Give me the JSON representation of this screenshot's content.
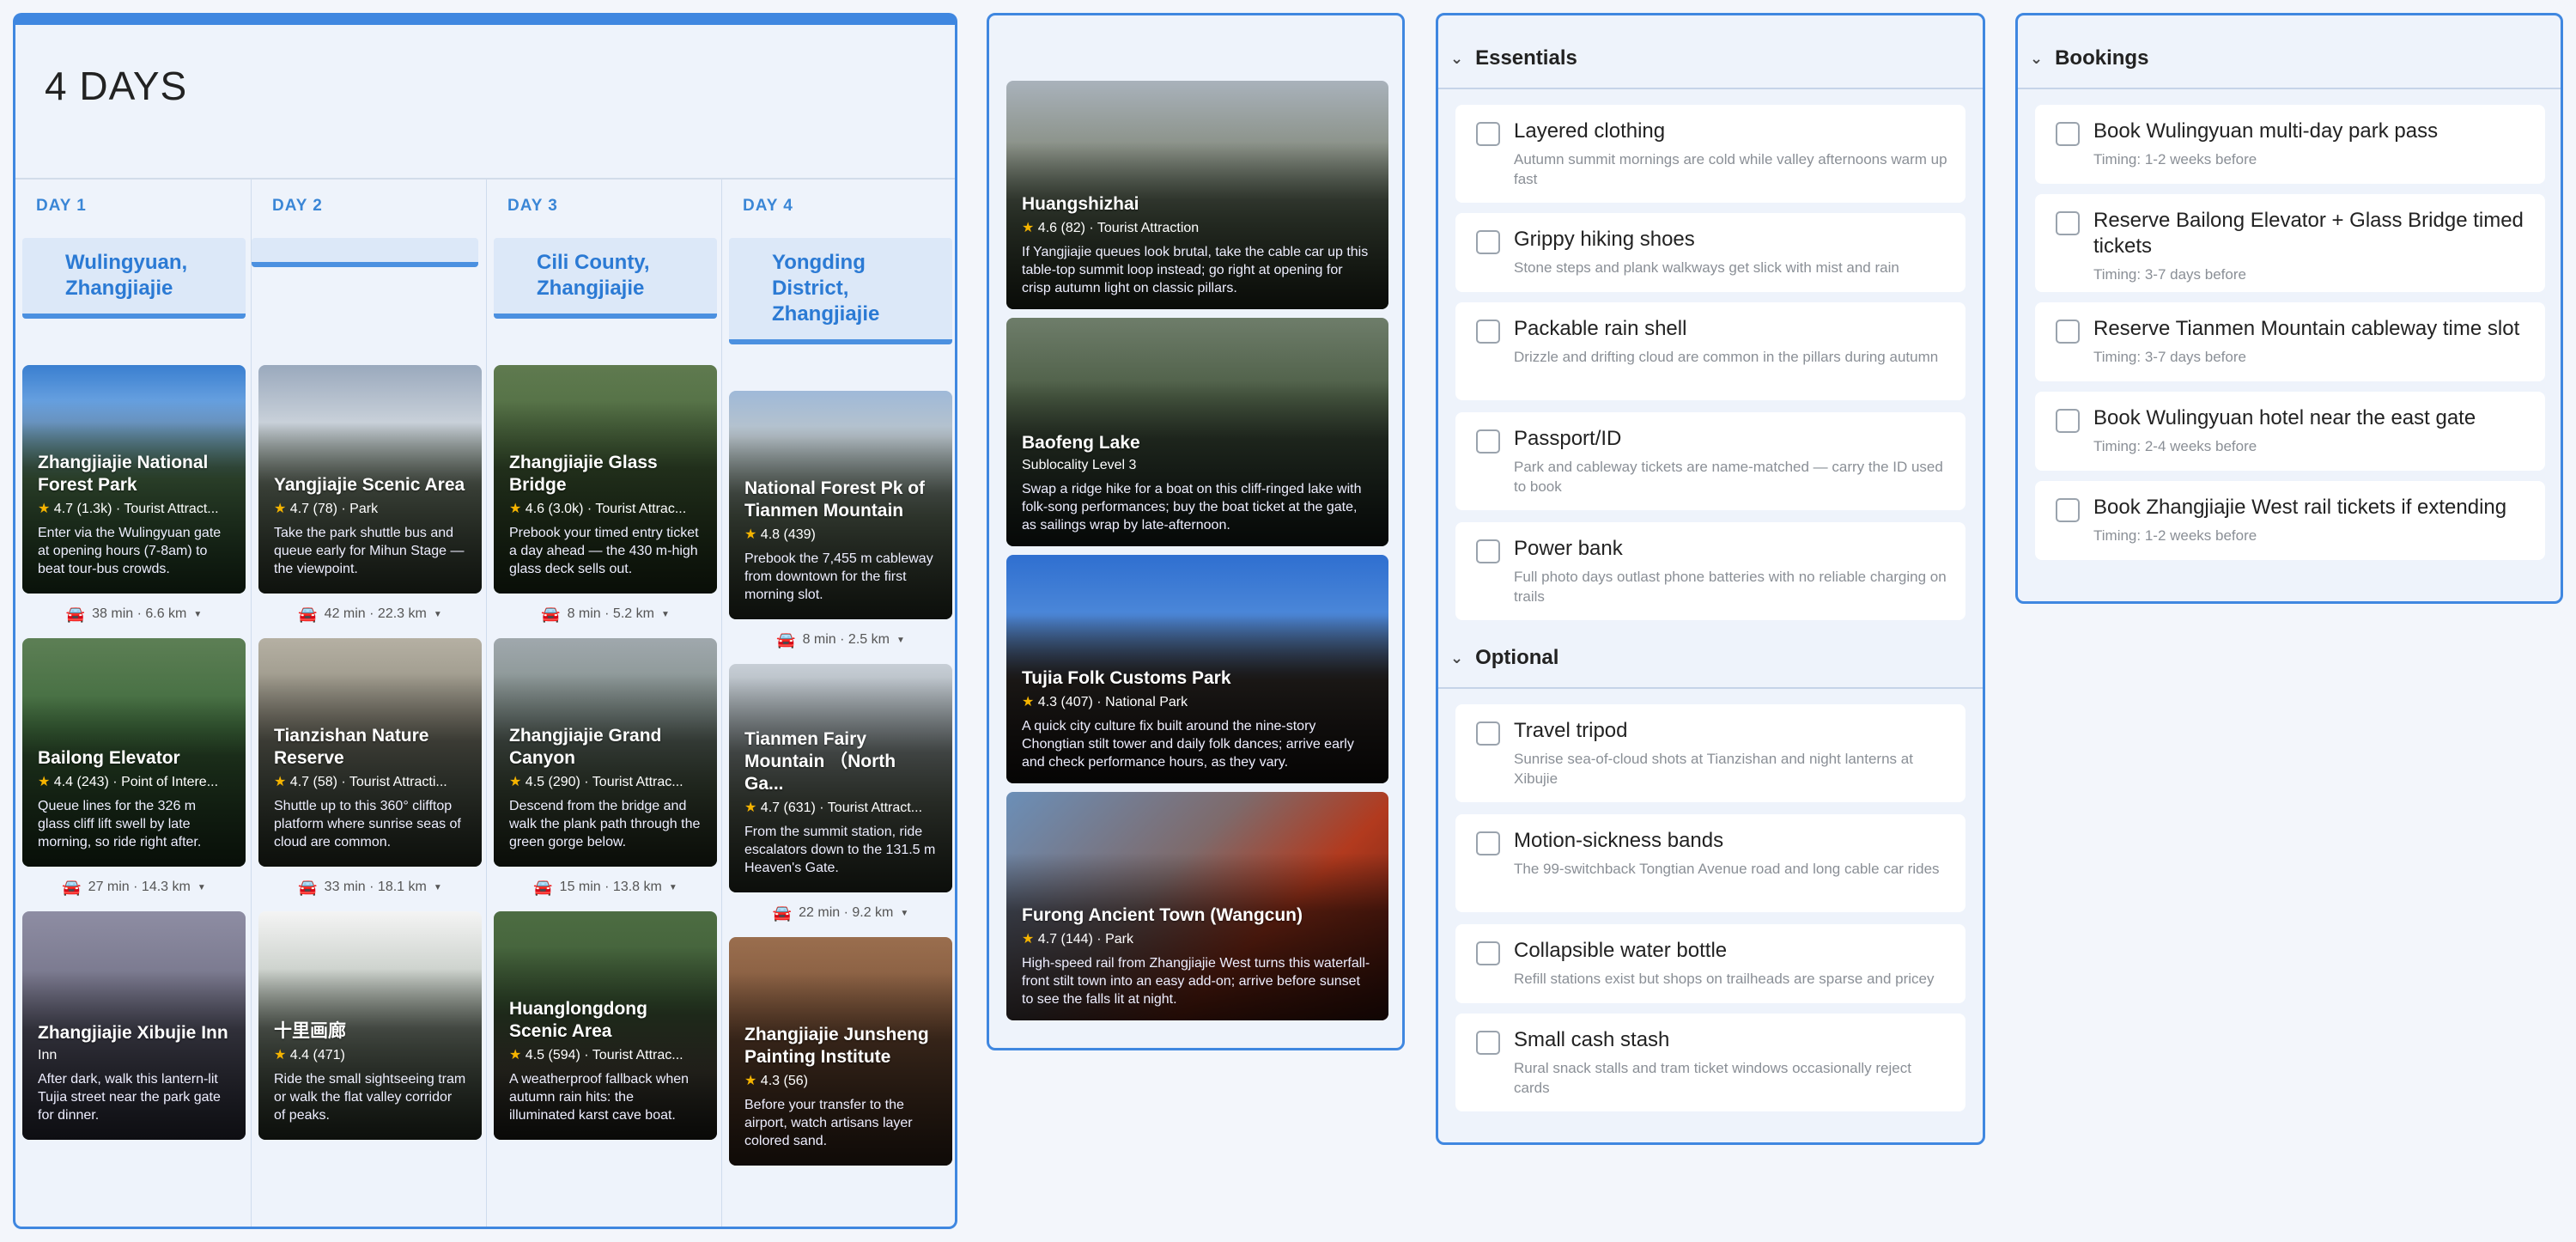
{
  "itinerary": {
    "title": "4 DAYS",
    "days": [
      {
        "label": "DAY 1",
        "location": "Wulingyuan, Zhangjiajie",
        "places": [
          {
            "name": "Zhangjiajie National Forest Park",
            "rating": "4.7",
            "reviews": "(1.3k)",
            "category": "Tourist Attract...",
            "desc": "Enter via the Wulingyuan gate at opening hours (7-8am) to beat tour-bus crowds."
          },
          {
            "name": "Bailong Elevator",
            "rating": "4.4",
            "reviews": "(243)",
            "category": "Point of Intere...",
            "desc": "Queue lines for the 326 m glass cliff lift swell by late morning, so ride right after."
          },
          {
            "name": "Zhangjiajie Xibujie Inn",
            "rating": "",
            "reviews": "",
            "category": "Inn",
            "desc": "After dark, walk this lantern-lit Tujia street near the park gate for dinner."
          }
        ],
        "travel": [
          {
            "text": "38 min · 6.6 km"
          },
          {
            "text": "27 min · 14.3 km"
          }
        ]
      },
      {
        "label": "DAY 2",
        "location": "",
        "places": [
          {
            "name": "Yangjiajie Scenic Area",
            "rating": "4.7",
            "reviews": "(78)",
            "category": "Park",
            "desc": "Take the park shuttle bus and queue early for Mihun Stage — the viewpoint."
          },
          {
            "name": "Tianzishan Nature Reserve",
            "rating": "4.7",
            "reviews": "(58)",
            "category": "Tourist Attracti...",
            "desc": "Shuttle up to this 360° clifftop platform where sunrise seas of cloud are common."
          },
          {
            "name": "十里画廊",
            "rating": "4.4",
            "reviews": "(471)",
            "category": "",
            "desc": "Ride the small sightseeing tram or walk the flat valley corridor of peaks."
          }
        ],
        "travel": [
          {
            "text": "42 min · 22.3 km"
          },
          {
            "text": "33 min · 18.1 km"
          }
        ]
      },
      {
        "label": "DAY 3",
        "location": "Cili County, Zhangjiajie",
        "places": [
          {
            "name": "Zhangjiajie Glass Bridge",
            "rating": "4.6",
            "reviews": "(3.0k)",
            "category": "Tourist Attrac...",
            "desc": "Prebook your timed entry ticket a day ahead — the 430 m-high glass deck sells out."
          },
          {
            "name": "Zhangjiajie Grand Canyon",
            "rating": "4.5",
            "reviews": "(290)",
            "category": "Tourist Attrac...",
            "desc": "Descend from the bridge and walk the plank path through the green gorge below."
          },
          {
            "name": "Huanglongdong Scenic Area",
            "rating": "4.5",
            "reviews": "(594)",
            "category": "Tourist Attrac...",
            "desc": "A weatherproof fallback when autumn rain hits: the illuminated karst cave boat."
          }
        ],
        "travel": [
          {
            "text": "8 min · 5.2 km"
          },
          {
            "text": "15 min · 13.8 km"
          }
        ]
      },
      {
        "label": "DAY 4",
        "location": "Yongding District, Zhangjiajie",
        "places": [
          {
            "name": "National Forest Pk of Tianmen Mountain",
            "rating": "4.8",
            "reviews": "(439)",
            "category": "",
            "desc": "Prebook the 7,455 m cableway from downtown for the first morning slot."
          },
          {
            "name": "Tianmen Fairy Mountain （North Ga...",
            "rating": "4.7",
            "reviews": "(631)",
            "category": "Tourist Attract...",
            "desc": "From the summit station, ride escalators down to the 131.5 m Heaven's Gate."
          },
          {
            "name": "Zhangjiajie Junsheng Painting Institute",
            "rating": "4.3",
            "reviews": "(56)",
            "category": "",
            "desc": "Before your transfer to the airport, watch artisans layer colored sand."
          }
        ],
        "travel": [
          {
            "text": "8 min · 2.5 km"
          },
          {
            "text": "22 min · 9.2 km"
          }
        ]
      }
    ]
  },
  "ideas": [
    {
      "name": "Huangshizhai",
      "rating": "4.6",
      "reviews": "(82)",
      "category": "Tourist Attraction",
      "desc": "If Yangjiajie queues look brutal, take the cable car up this table-top summit loop instead; go right at opening for crisp autumn light on classic pillars."
    },
    {
      "name": "Baofeng Lake",
      "rating": "",
      "reviews": "",
      "category": "Sublocality Level 3",
      "desc": "Swap a ridge hike for a boat on this cliff-ringed lake with folk-song performances; buy the boat ticket at the gate, as sailings wrap by late-afternoon."
    },
    {
      "name": "Tujia Folk Customs Park",
      "rating": "4.3",
      "reviews": "(407)",
      "category": "National Park",
      "desc": "A quick city culture fix built around the nine-story Chongtian stilt tower and daily folk dances; arrive early and check performance hours, as they vary."
    },
    {
      "name": "Furong Ancient Town (Wangcun)",
      "rating": "4.7",
      "reviews": "(144)",
      "category": "Park",
      "desc": "High-speed rail from Zhangjiajie West turns this waterfall-front stilt town into an easy add-on; arrive before sunset to see the falls lit at night."
    }
  ],
  "essentials": {
    "title": "Essentials",
    "items": [
      {
        "title": "Layered clothing",
        "sub": "Autumn summit mornings are cold while valley afternoons warm up fast"
      },
      {
        "title": "Grippy hiking shoes",
        "sub": "Stone steps and plank walkways get slick with mist and rain"
      },
      {
        "title": "Packable rain shell",
        "sub": "Drizzle and drifting cloud are common in the pillars during autumn"
      },
      {
        "title": "Passport/ID",
        "sub": "Park and cableway tickets are name-matched — carry the ID used to book"
      },
      {
        "title": "Power bank",
        "sub": "Full photo days outlast phone batteries with no reliable charging on trails"
      }
    ]
  },
  "optional": {
    "title": "Optional",
    "items": [
      {
        "title": "Travel tripod",
        "sub": "Sunrise sea-of-cloud shots at Tianzishan and night lanterns at Xibujie"
      },
      {
        "title": "Motion-sickness bands",
        "sub": "The 99-switchback Tongtian Avenue road and long cable car rides"
      },
      {
        "title": "Collapsible water bottle",
        "sub": "Refill stations exist but shops on trailheads are sparse and pricey"
      },
      {
        "title": "Small cash stash",
        "sub": "Rural snack stalls and tram ticket windows occasionally reject cards"
      }
    ]
  },
  "bookings": {
    "title": "Bookings",
    "items": [
      {
        "title": "Book Wulingyuan multi-day park pass",
        "sub": "Timing: 1-2 weeks before"
      },
      {
        "title": "Reserve Bailong Elevator + Glass Bridge timed tickets",
        "sub": "Timing: 3-7 days before"
      },
      {
        "title": "Reserve Tianmen Mountain cableway time slot",
        "sub": "Timing: 3-7 days before"
      },
      {
        "title": "Book Wulingyuan hotel near the east gate",
        "sub": "Timing: 2-4 weeks before"
      },
      {
        "title": "Book Zhangjiajie West rail tickets if extending",
        "sub": "Timing: 1-2 weeks before"
      }
    ]
  },
  "icons": {
    "car": "car-icon",
    "chevron": "chevron-down-icon",
    "star": "star-icon",
    "caret": "caret-down-icon"
  },
  "colors": {
    "accent": "#3f87e0",
    "location_text": "#2b7ad4",
    "star": "#f5b400",
    "panel_bg": "#eef3fb"
  }
}
